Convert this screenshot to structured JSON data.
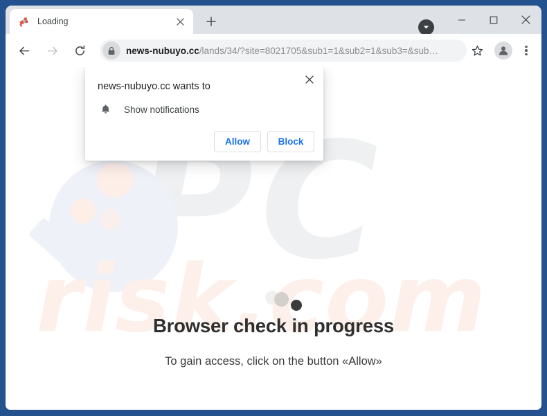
{
  "window": {
    "frame_color": "#23528e",
    "controls": {
      "tabstrip_dropdown_icon": "chevron-down-circle-icon",
      "minimize_label": "–",
      "maximize_label": "□",
      "close_label": "✕"
    }
  },
  "tab_strip": {
    "tabs": [
      {
        "title": "Loading",
        "favicon_icon": "megaphone-favicon",
        "close_label": "✕",
        "active": true
      }
    ],
    "new_tab_label": "+"
  },
  "toolbar": {
    "back_icon": "arrow-left-icon",
    "forward_icon": "arrow-right-icon",
    "reload_icon": "reload-icon",
    "lock_icon": "lock-icon",
    "url_bold": "news-nubuyo.cc",
    "url_rest": "/lands/34/?site=8021705&sub1=1&sub2=1&sub3=&sub…",
    "url_full": "news-nubuyo.cc/lands/34/?site=8021705&sub1=1&sub2=1&sub3=&sub…",
    "url_placeholder": "Search Google or type a URL",
    "bookmark_icon": "star-icon",
    "profile_icon": "person-avatar-icon",
    "menu_icon": "three-dot-menu-icon"
  },
  "permission_dialog": {
    "title": "news-nubuyo.cc wants to",
    "permission_icon": "bell-icon",
    "permission_label": "Show notifications",
    "allow_label": "Allow",
    "block_label": "Block",
    "close_label": "✕",
    "accent_color": "#1a73e8"
  },
  "page": {
    "heading": "Browser check in progress",
    "subtext": "To gain access, click on the button «Allow»",
    "loading_dots": 3
  },
  "watermark": {
    "primary_text": "PC",
    "secondary_text": "risk.com",
    "glass_icon": "magnifying-glass-watermark",
    "primary_color": "#eef0f2",
    "secondary_color": "#fdf0ea"
  }
}
